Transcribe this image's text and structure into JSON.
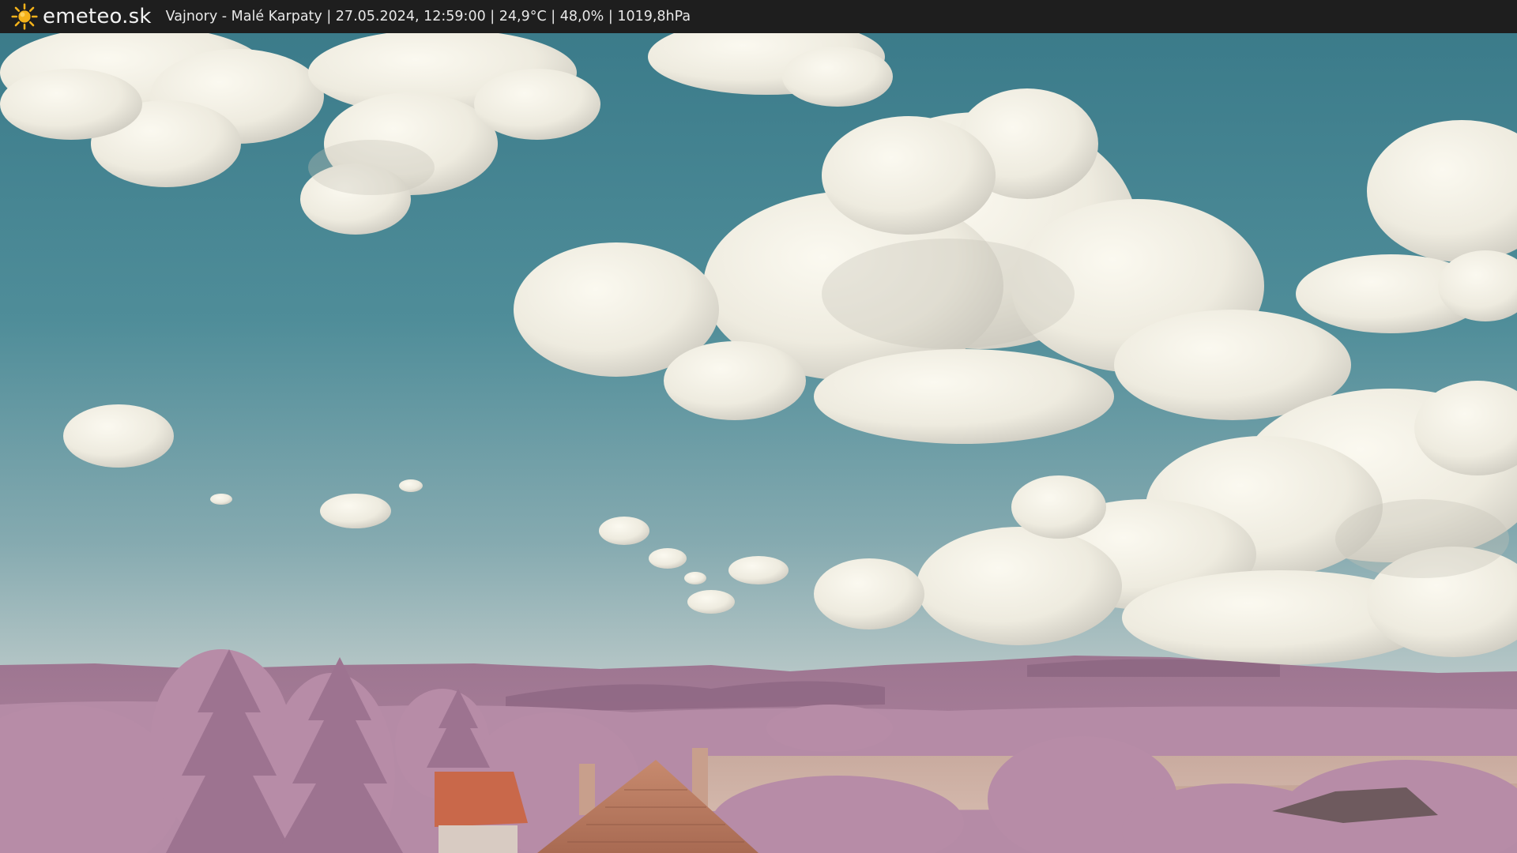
{
  "header": {
    "brand": "emeteo.sk",
    "brand_icon": "sun-icon",
    "caption": "Vajnory - Malé Karpaty | 27.05.2024, 12:59:00 | 24,9°C | 48,0% | 1019,8hPa"
  },
  "colors": {
    "bar_background": "#1e1e1e",
    "sun": "#f5b21a",
    "sky_top": "#3f7f8d",
    "sky_horizon": "#b9c9c9",
    "cloud": "#f2f0e6",
    "foliage": "#b98aa6",
    "hills": "#9a6f8b",
    "roof": "#c96a4b"
  }
}
